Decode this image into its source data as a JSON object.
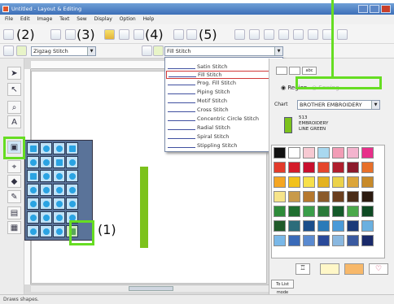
{
  "window": {
    "title": "Untitled - Layout & Editing"
  },
  "menubar": {
    "items": [
      "File",
      "Edit",
      "Image",
      "Text",
      "Sew",
      "Display",
      "Option",
      "Help"
    ]
  },
  "callouts": [
    "(1)",
    "(2)",
    "(3)",
    "(4)",
    "(5)"
  ],
  "toolbar2": {
    "line_stitch": "Zigzag Stitch",
    "region_stitch": "Fill Stitch"
  },
  "stitch_menu": {
    "items": [
      "Satin Stitch",
      "Fill Stitch",
      "Prog. Fill Stitch",
      "Piping Stitch",
      "Motif Stitch",
      "Cross Stitch",
      "Concentric Circle Stitch",
      "Radial Stitch",
      "Spiral Stitch",
      "Stippling Stitch"
    ],
    "selected": "Fill Stitch"
  },
  "right_panel": {
    "tab": "abc",
    "region_label": "Region",
    "other_label": "Sewing",
    "chart_label": "Chart",
    "chart_value": "BROTHER EMBROIDERY",
    "thread_number": "513",
    "thread_brand": "EMBROIDERY",
    "thread_name": "LINE GREEN",
    "list_mode_label": "To List mode"
  },
  "status": {
    "text": "Draws shapes."
  },
  "colors": {
    "accent_highlight": "#66dd22",
    "canvas_object": "#7cc21c",
    "selection_border": "#d03838"
  }
}
